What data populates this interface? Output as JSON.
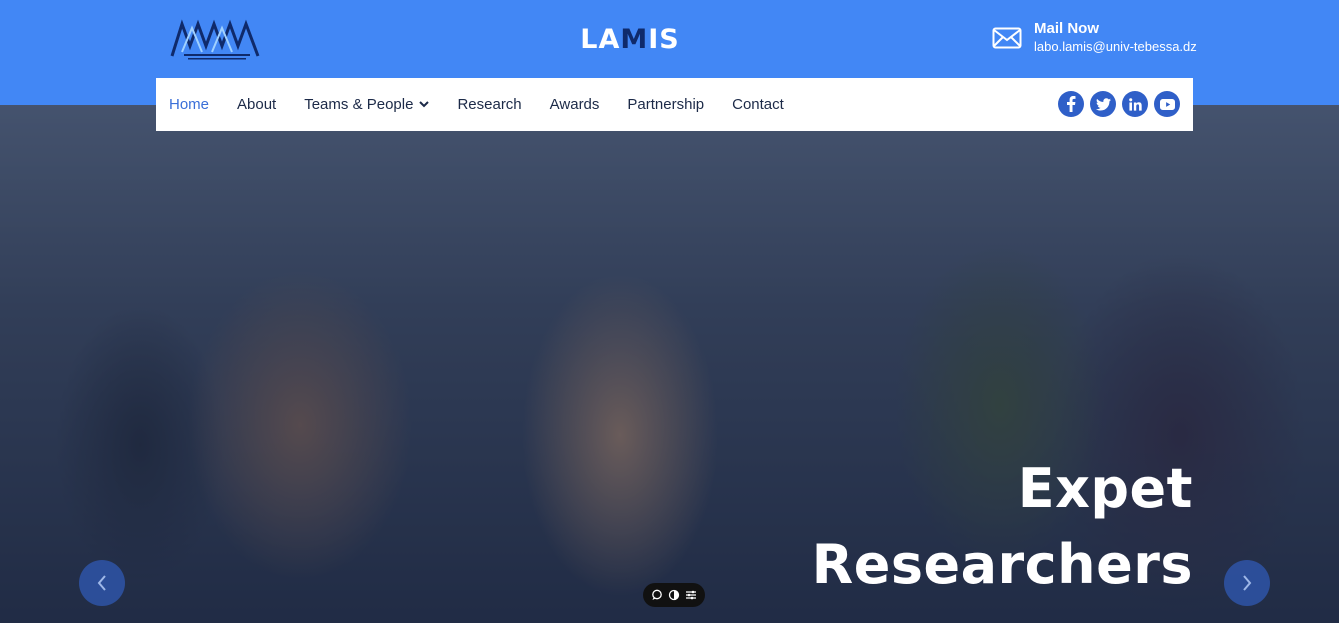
{
  "header": {
    "title_part1": "LA",
    "title_part2": "M",
    "title_part3": "IS",
    "mail_label": "Mail Now",
    "mail_address": "labo.lamis@univ-tebessa.dz",
    "logo_icon": "lamis-logo-icon",
    "mail_icon": "envelope-icon"
  },
  "nav": {
    "items": [
      {
        "label": "Home",
        "active": true
      },
      {
        "label": "About"
      },
      {
        "label": "Teams & People",
        "has_dropdown": true
      },
      {
        "label": "Research"
      },
      {
        "label": "Awards"
      },
      {
        "label": "Partnership"
      },
      {
        "label": "Contact"
      }
    ],
    "social": [
      {
        "label": "f",
        "icon": "facebook-icon"
      },
      {
        "label": "t",
        "icon": "twitter-icon"
      },
      {
        "label": "in",
        "icon": "linkedin-icon"
      },
      {
        "label": "yt",
        "icon": "youtube-icon"
      }
    ]
  },
  "hero": {
    "line1": "Expet",
    "line2": "Researchers",
    "prev_icon": "chevron-left-icon",
    "next_icon": "chevron-right-icon"
  },
  "colors": {
    "accent": "#4287f5",
    "nav_active": "#3a6fd8",
    "social_bg": "#2f5fc8"
  }
}
